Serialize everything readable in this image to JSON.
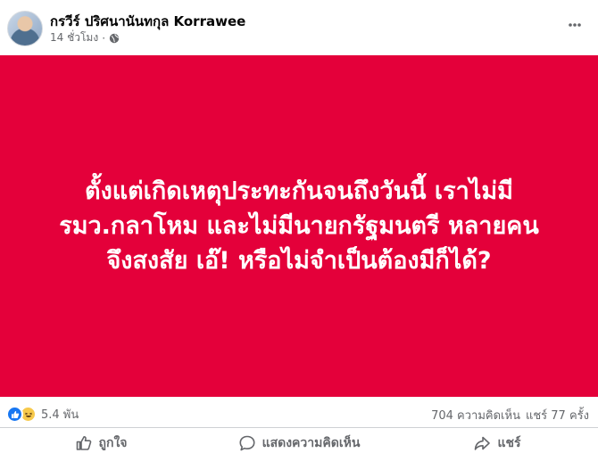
{
  "post": {
    "author": "กรวีร์ ปริศนานันทกุล Korrawee",
    "time": "14 ชั่วโมง",
    "separator": "·",
    "privacy_icon": "globe-icon",
    "more_icon": "more-dots-icon",
    "body_lines": [
      "ตั้งแต่เกิดเหตุประทะกันจนถึงวันนี้ เราไม่มี",
      "รมว.กลาโหม และไม่มีนายกรัฐมนตรี หลายคน",
      "จึงสงสัย เอ๊! หรือไม่จำเป็นต้องมีก็ได้?"
    ],
    "background_color": "#e4003a"
  },
  "stats": {
    "reaction_icons": [
      "like-reaction-icon",
      "haha-reaction-icon"
    ],
    "reaction_count": "5.4 พัน",
    "comments": "704 ความคิดเห็น",
    "shares": "แชร์ 77 ครั้ง"
  },
  "actions": {
    "like": {
      "label": "ถูกใจ",
      "icon": "thumbs-up-icon"
    },
    "comment": {
      "label": "แสดงความคิดเห็น",
      "icon": "comment-icon"
    },
    "share": {
      "label": "แชร์",
      "icon": "share-icon"
    }
  }
}
